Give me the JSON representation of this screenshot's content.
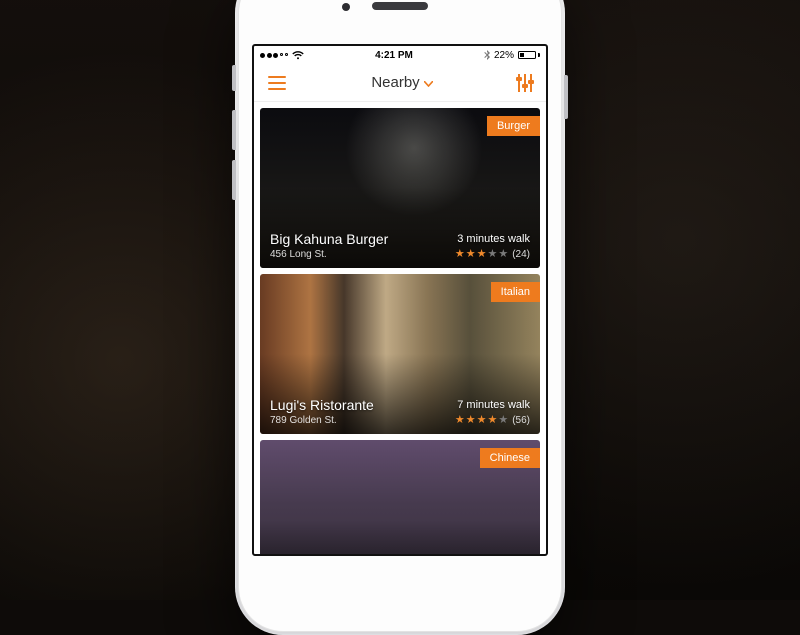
{
  "status": {
    "carrier_dots_filled": 3,
    "carrier_dots_total": 5,
    "time": "4:21 PM",
    "battery_text": "22%"
  },
  "navbar": {
    "title": "Nearby"
  },
  "cards": [
    {
      "tag": "Burger",
      "name": "Big Kahuna Burger",
      "address": "456 Long St.",
      "distance": "3 minutes walk",
      "rating": 3,
      "rating_max": 5,
      "review_count": "(24)"
    },
    {
      "tag": "Italian",
      "name": "Lugi's Ristorante",
      "address": "789 Golden St.",
      "distance": "7 minutes walk",
      "rating": 4,
      "rating_max": 5,
      "review_count": "(56)"
    },
    {
      "tag": "Chinese",
      "name": "",
      "address": "",
      "distance": "",
      "rating": 0,
      "rating_max": 5,
      "review_count": ""
    }
  ],
  "colors": {
    "accent": "#ed7b1f"
  }
}
